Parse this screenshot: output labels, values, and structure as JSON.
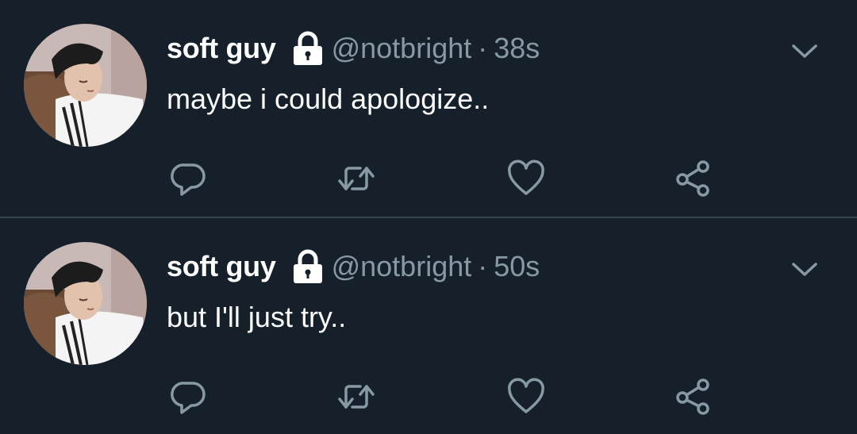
{
  "colors": {
    "background": "#15202b",
    "divider": "#38444d",
    "primary_text": "#ffffff",
    "secondary_text": "#8899a6"
  },
  "tweets": [
    {
      "display_name": "soft guy",
      "protected_icon": "lock-icon",
      "handle": "@notbright",
      "separator": "·",
      "time": "38s",
      "text": "maybe i could apologize..",
      "menu_icon": "chevron-down-icon",
      "actions": [
        "reply-icon",
        "retweet-icon",
        "like-icon",
        "share-icon"
      ]
    },
    {
      "display_name": "soft guy",
      "protected_icon": "lock-icon",
      "handle": "@notbright",
      "separator": "·",
      "time": "50s",
      "text": "but I'll just try..",
      "menu_icon": "chevron-down-icon",
      "actions": [
        "reply-icon",
        "retweet-icon",
        "like-icon",
        "share-icon"
      ]
    }
  ]
}
